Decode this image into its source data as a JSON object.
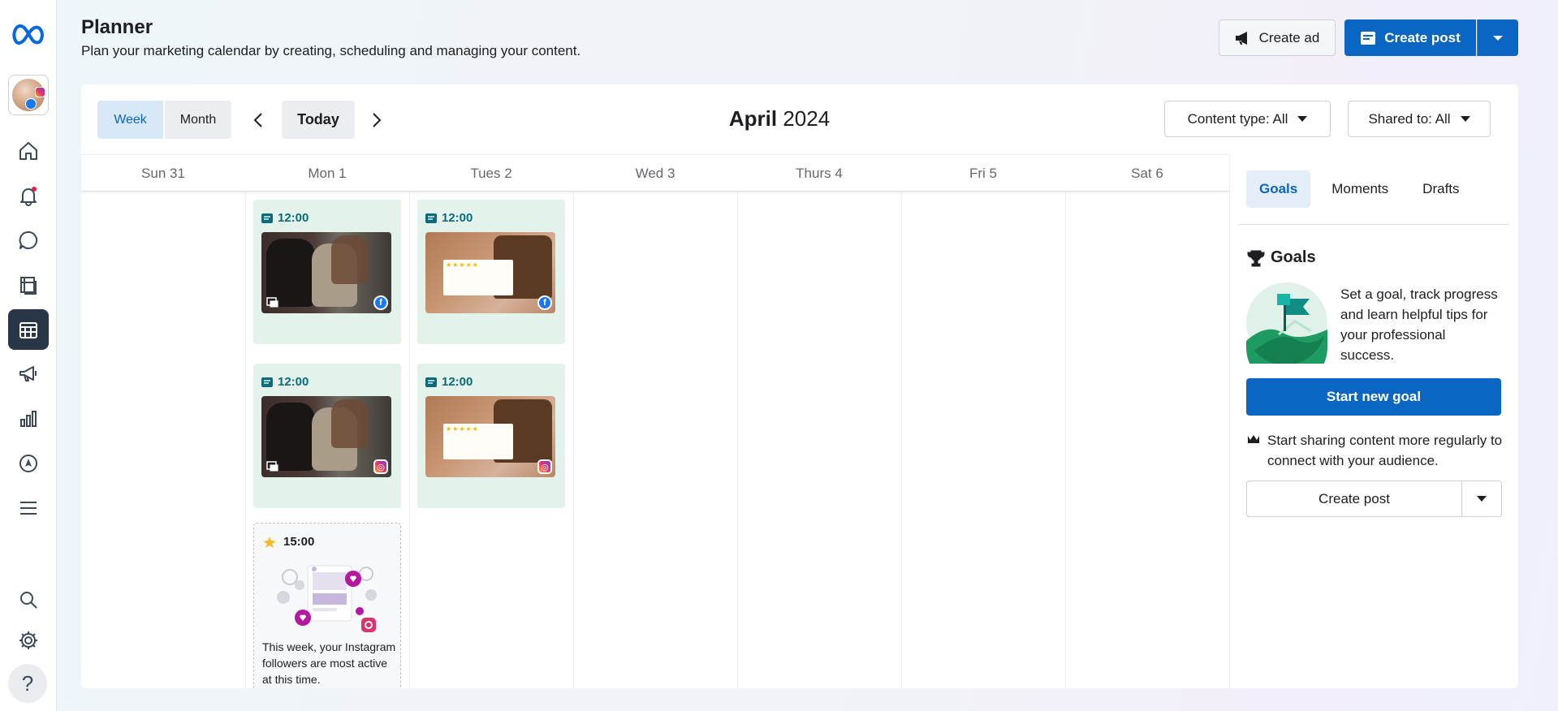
{
  "header": {
    "title": "Planner",
    "subtitle": "Plan your marketing calendar by creating, scheduling and managing your content.",
    "create_ad_label": "Create ad",
    "create_post_label": "Create post"
  },
  "toolbar": {
    "week_label": "Week",
    "month_label": "Month",
    "today_label": "Today",
    "month_name": "April",
    "year": "2024",
    "content_type_label": "Content type: All",
    "shared_to_label": "Shared to: All"
  },
  "calendar": {
    "days": [
      "Sun 31",
      "Mon 1",
      "Tues 2",
      "Wed 3",
      "Thurs 4",
      "Fri 5",
      "Sat 6"
    ],
    "posts": [
      {
        "time": "12:00",
        "network": "facebook-icon",
        "image": "bags"
      },
      {
        "time": "12:00",
        "network": "facebook-icon",
        "image": "review"
      },
      {
        "time": "12:00",
        "network": "instagram-icon",
        "image": "bags"
      },
      {
        "time": "12:00",
        "network": "instagram-icon",
        "image": "review"
      }
    ],
    "suggestion": {
      "time": "15:00",
      "text": "This week, your Instagram followers are most active at this time."
    }
  },
  "right_panel": {
    "tabs": [
      "Goals",
      "Moments",
      "Drafts"
    ],
    "goals_title": "Goals",
    "goals_description": "Set a goal, track progress and learn helpful tips for your professional success.",
    "start_goal_label": "Start new goal",
    "tip_text": "Start sharing content more regularly to connect with your audience.",
    "create_post_label": "Create post"
  },
  "colors": {
    "primary": "#0a66c2",
    "nav_active": "#283647",
    "post_card_bg": "#e3f3ec",
    "time_text": "#0b6b7a"
  }
}
